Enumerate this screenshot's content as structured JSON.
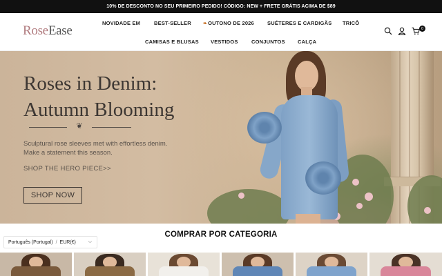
{
  "promo": {
    "text": "10% DE DESCONTO NO SEU PRIMEIRO PEDIDO! CÓDIGO: NEW + FRETE GRÁTIS ACIMA DE $89"
  },
  "header": {
    "logo_part1": "Rose",
    "logo_part2": "Ease",
    "nav": [
      {
        "label": "NOVIDADE EM"
      },
      {
        "label": "BEST-SELLER"
      },
      {
        "label": "OUTONO DE 2026",
        "icon": "maple-leaf-icon"
      },
      {
        "label": "SUÉTERES E CARDIGÃS"
      },
      {
        "label": "TRICÔ"
      },
      {
        "label": "CAMISAS E BLUSAS"
      },
      {
        "label": "VESTIDOS"
      },
      {
        "label": "CONJUNTOS"
      },
      {
        "label": "CALÇA"
      }
    ],
    "icons": {
      "search": "search-icon",
      "account": "user-icon",
      "cart": "cart-icon"
    },
    "cart_count": "0"
  },
  "hero": {
    "title_line1": "Roses in Denim:",
    "title_line2": "Autumn Blooming",
    "subtitle_line1": "Sculptural rose sleeves met with effortless denim.",
    "subtitle_line2": "Make a statement this season.",
    "link": "SHOP THE HERO PIECE>>",
    "button": "SHOP NOW"
  },
  "categories": {
    "title": "COMPRAR POR CATEGORIA",
    "thumbs": [
      {
        "hair": "#4a2f1e",
        "top": "#7a5a3c"
      },
      {
        "hair": "#3a2a20",
        "top": "#8b6a44"
      },
      {
        "hair": "#6b4a32",
        "top": "#f2f0ec"
      },
      {
        "hair": "#5a3a26",
        "top": "#5f86b6"
      },
      {
        "hair": "#6a4a34",
        "top": "#7fa3cc"
      },
      {
        "hair": "#4a3226",
        "top": "#d9869a"
      },
      {
        "hair": "#5b4030",
        "top": "#6a8fbf"
      }
    ]
  },
  "locale": {
    "language": "Português (Portugal)",
    "currency": "EUR(€)"
  },
  "colors": {
    "promo_bg": "#111111",
    "logo_rose": "#b07a7e",
    "hero_text": "#3d3733"
  }
}
